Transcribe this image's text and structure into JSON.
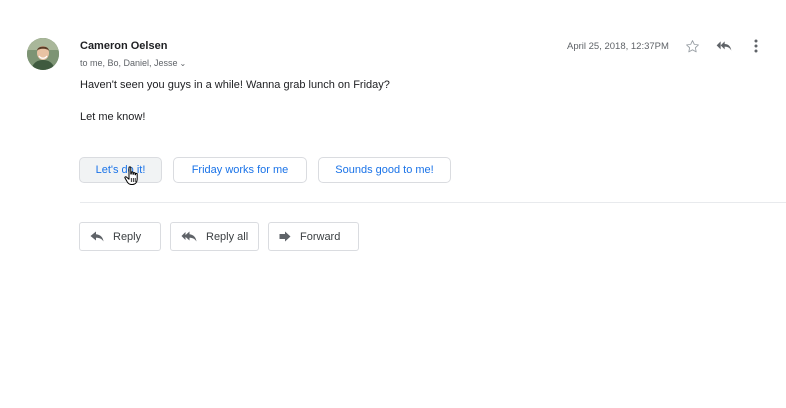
{
  "message": {
    "sender": "Cameron Oelsen",
    "recipients": "to me, Bo, Daniel, Jesse",
    "date": "April 25, 2018, 12:37PM",
    "body_lines": [
      "Haven't seen you guys in a while! Wanna grab lunch on Friday?",
      "Let me know!"
    ]
  },
  "smart_replies": [
    "Let's do it!",
    "Friday works for me",
    "Sounds good to me!"
  ],
  "actions": {
    "reply": "Reply",
    "reply_all": "Reply all",
    "forward": "Forward"
  },
  "icons": {
    "star": "star-outline-icon",
    "reply": "reply-icon",
    "more": "more-vertical-icon",
    "reply_all": "reply-all-icon",
    "forward": "forward-icon",
    "cursor": "hand-pointer-icon"
  },
  "colors": {
    "link_blue": "#1a73e8",
    "icon_grey": "#5f6368",
    "border": "#dadce0"
  }
}
